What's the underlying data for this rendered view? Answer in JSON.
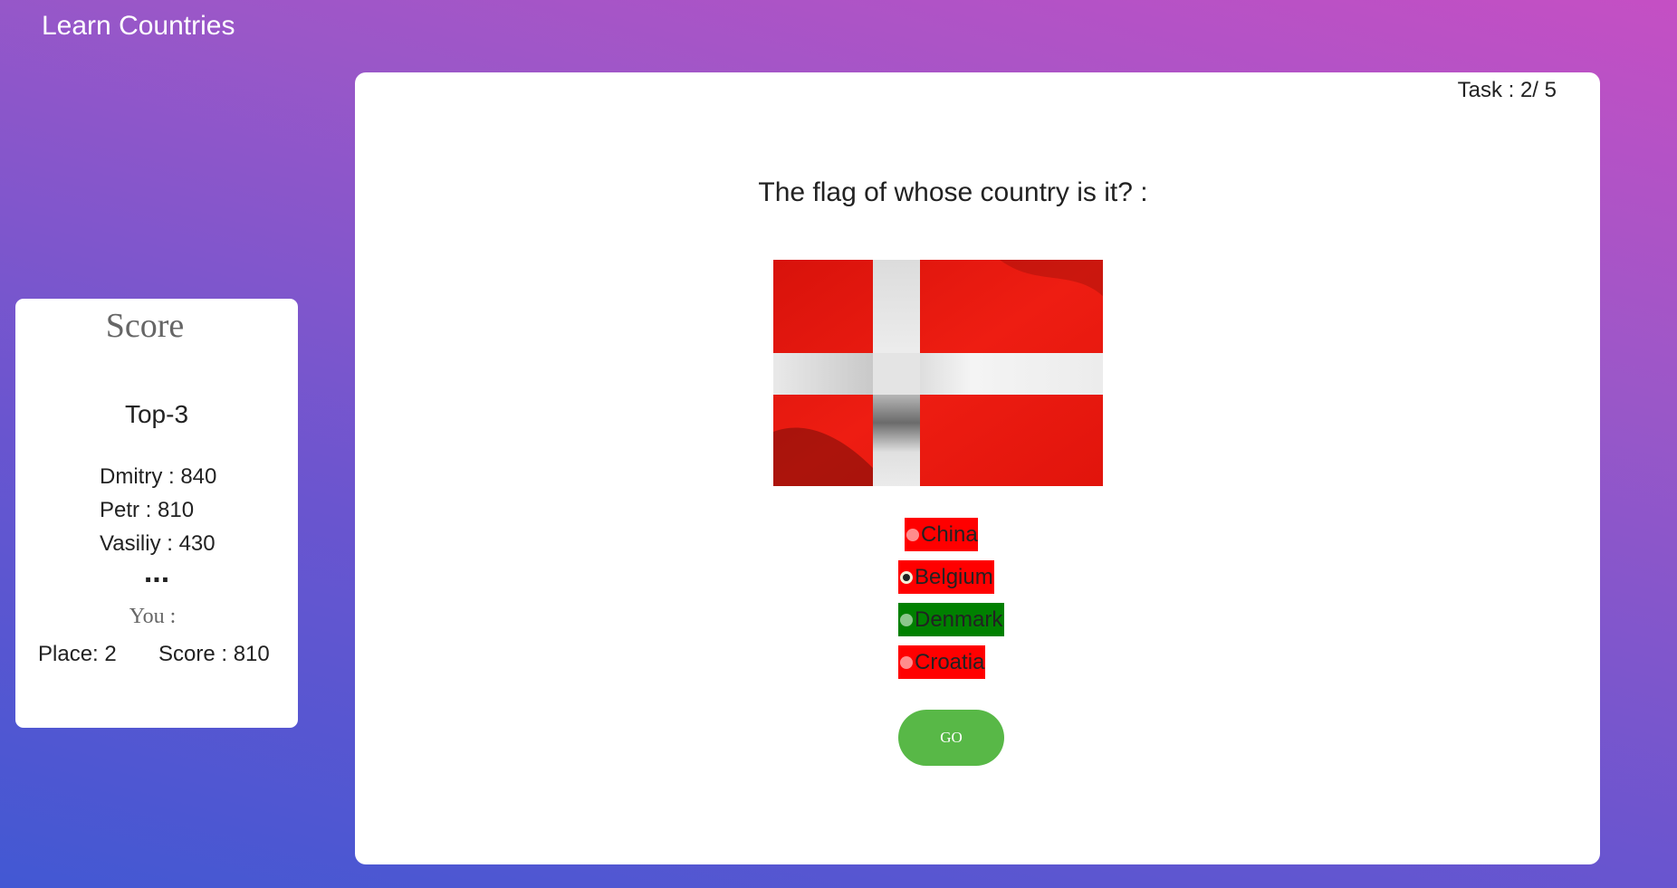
{
  "app": {
    "title": "Learn Countries"
  },
  "score_panel": {
    "title": "Score",
    "top_heading": "Top-3",
    "leaders": [
      "Dmitry : 840",
      "Petr : 810",
      "Vasiliy : 430"
    ],
    "ellipsis": "...",
    "you_label": "You :",
    "place": "Place: 2",
    "score": "Score : 810"
  },
  "quiz": {
    "task": "Task : 2/ 5",
    "question": "The flag of whose country is it? :",
    "flag_icon": "denmark-flag-icon",
    "options": [
      {
        "label": "China",
        "state": "wrong",
        "checked": false
      },
      {
        "label": "Belgium",
        "state": "wrong",
        "checked": true
      },
      {
        "label": "Denmark",
        "state": "correct",
        "checked": false
      },
      {
        "label": "Croatia",
        "state": "wrong",
        "checked": false
      }
    ],
    "go_label": "GO"
  },
  "colors": {
    "wrong": "#ff0000",
    "correct": "#008000",
    "go_button": "#58b847",
    "flag_red": "#e0120c",
    "flag_white": "#f2f2f2"
  }
}
